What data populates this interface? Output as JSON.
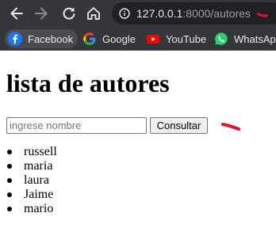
{
  "browser": {
    "address_bar": {
      "host": "127.0.0.1",
      "rest": ":8000/autores"
    },
    "bookmarks": [
      {
        "label": "Facebook",
        "icon": "facebook-icon"
      },
      {
        "label": "Google",
        "icon": "google-icon"
      },
      {
        "label": "YouTube",
        "icon": "youtube-icon"
      },
      {
        "label": "WhatsApp",
        "icon": "whatsapp-icon"
      }
    ],
    "colors": {
      "chrome_bg": "#35363a",
      "omnibox_bg": "#202124",
      "annotation_red": "#e8102c"
    }
  },
  "page": {
    "title": "lista de autores",
    "search": {
      "placeholder": "ingrese nombre",
      "value": ""
    },
    "submit_label": "Consultar",
    "authors": [
      "russell",
      "maria",
      "laura",
      "Jaime",
      "mario"
    ]
  }
}
